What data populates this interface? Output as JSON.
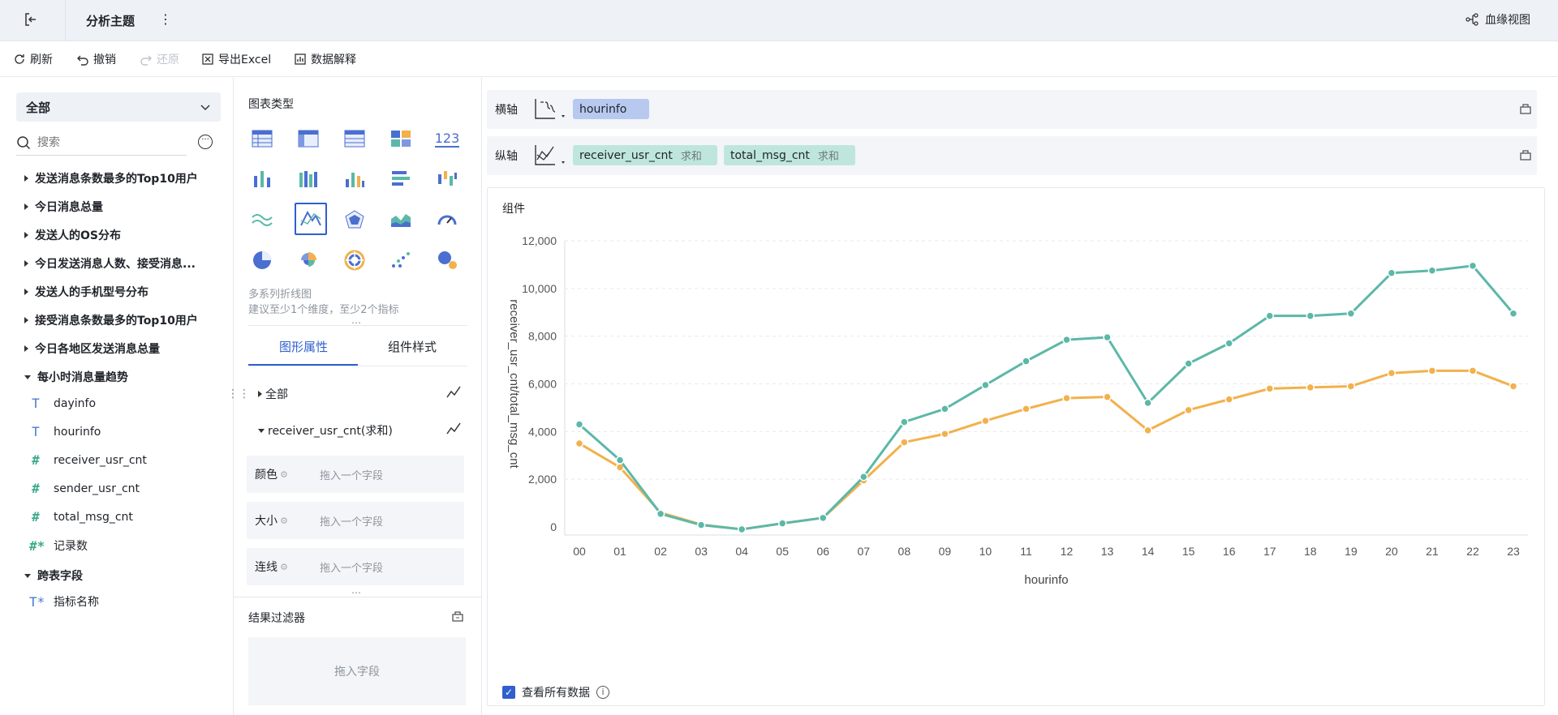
{
  "topbar": {
    "title": "分析主题",
    "more_icon": "more-vertical-icon",
    "back_icon": "exit-icon",
    "lineage_label": "血缘视图"
  },
  "toolbar": {
    "refresh": "刷新",
    "undo": "撤销",
    "redo": "还原",
    "export": "导出Excel",
    "explain": "数据解释"
  },
  "left": {
    "dropdown_value": "全部",
    "search_placeholder": "搜索",
    "topics": [
      "发送消息条数最多的Top10用户",
      "今日消息总量",
      "发送人的OS分布",
      "今日发送消息人数、接受消息...",
      "发送人的手机型号分布",
      "接受消息条数最多的Top10用户",
      "今日各地区发送消息总量",
      "每小时消息量趋势"
    ],
    "fields": [
      {
        "type": "T",
        "name": "dayinfo"
      },
      {
        "type": "T",
        "name": "hourinfo"
      },
      {
        "type": "#",
        "name": "receiver_usr_cnt"
      },
      {
        "type": "#",
        "name": "sender_usr_cnt"
      },
      {
        "type": "#",
        "name": "total_msg_cnt"
      },
      {
        "type": "#*",
        "name": "记录数"
      }
    ],
    "cross_table": "跨表字段",
    "cross_fields": [
      {
        "type": "T*",
        "name": "指标名称"
      }
    ]
  },
  "middle": {
    "chart_type_label": "图表类型",
    "kpi_icon_text": "123",
    "hint_title": "多系列折线图",
    "hint_desc": "建议至少1个维度，至少2个指标",
    "tab_props": "图形属性",
    "tab_style": "组件样式",
    "all_label": "全部",
    "series_label": "receiver_usr_cnt(求和)",
    "props": [
      {
        "label": "颜色",
        "placeholder": "拖入一个字段"
      },
      {
        "label": "大小",
        "placeholder": "拖入一个字段"
      },
      {
        "label": "连线",
        "placeholder": "拖入一个字段"
      }
    ],
    "filter_label": "结果过滤器",
    "filter_placeholder": "拖入字段"
  },
  "right": {
    "x_shelf_label": "横轴",
    "y_shelf_label": "纵轴",
    "x_pill": "hourinfo",
    "y_pills": [
      {
        "name": "receiver_usr_cnt",
        "agg": "求和"
      },
      {
        "name": "total_msg_cnt",
        "agg": "求和"
      }
    ],
    "card_title": "组件",
    "show_all_label": "查看所有数据"
  },
  "colors": {
    "teal": "#5cb8a8",
    "orange": "#f2b14c",
    "accent": "#2f5fd0"
  },
  "chart_data": {
    "type": "line",
    "xlabel": "hourinfo",
    "ylabel": "receiver_usr_cnt/total_msg_cnt",
    "ylim": [
      0,
      12000
    ],
    "y_ticks": [
      "0",
      "2,000",
      "4,000",
      "6,000",
      "8,000",
      "10,000",
      "12,000"
    ],
    "categories": [
      "00",
      "01",
      "02",
      "03",
      "04",
      "05",
      "06",
      "07",
      "08",
      "09",
      "10",
      "11",
      "12",
      "13",
      "14",
      "15",
      "16",
      "17",
      "18",
      "19",
      "20",
      "21",
      "22",
      "23"
    ],
    "series": [
      {
        "color": "#5cb8a8",
        "values": [
          4300,
          2800,
          550,
          80,
          -100,
          150,
          380,
          2100,
          4400,
          4950,
          5950,
          6950,
          7850,
          7950,
          5200,
          6850,
          7700,
          8850,
          8850,
          8950,
          10650,
          10750,
          10950,
          8950
        ]
      },
      {
        "color": "#f2b14c",
        "values": [
          3500,
          2500,
          600,
          100,
          -100,
          150,
          380,
          1950,
          3550,
          3900,
          4450,
          4950,
          5400,
          5450,
          4050,
          4900,
          5350,
          5800,
          5850,
          5900,
          6450,
          6550,
          6550,
          5900
        ]
      }
    ],
    "grid": true
  }
}
